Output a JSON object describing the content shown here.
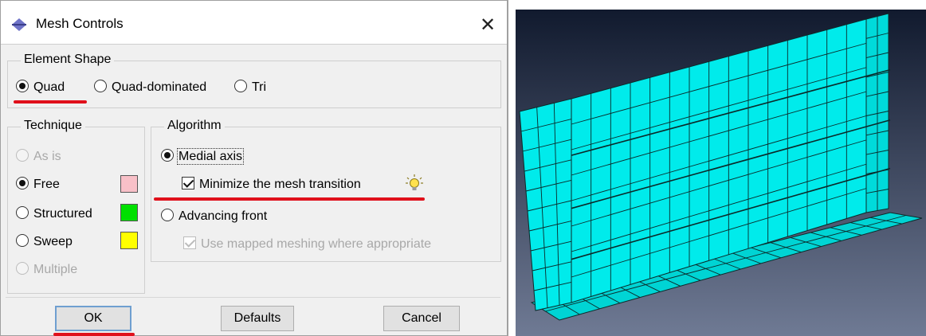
{
  "dialog": {
    "title": "Mesh Controls",
    "close_glyph": "✕",
    "icons": {
      "app": "mesh-controls-icon",
      "close": "close-icon",
      "hint": "lightbulb-icon"
    },
    "element_shape": {
      "legend": "Element Shape",
      "options": [
        {
          "label": "Quad",
          "selected": true
        },
        {
          "label": "Quad-dominated",
          "selected": false
        },
        {
          "label": "Tri",
          "selected": false
        }
      ]
    },
    "technique": {
      "legend": "Technique",
      "options": [
        {
          "label": "As is",
          "selected": false,
          "enabled": false
        },
        {
          "label": "Free",
          "selected": true,
          "enabled": true,
          "color": "#f8c0c8"
        },
        {
          "label": "Structured",
          "selected": false,
          "enabled": true,
          "color": "#00e000"
        },
        {
          "label": "Sweep",
          "selected": false,
          "enabled": true,
          "color": "#ffff00"
        },
        {
          "label": "Multiple",
          "selected": false,
          "enabled": false
        }
      ]
    },
    "algorithm": {
      "legend": "Algorithm",
      "medial_axis": {
        "label": "Medial axis",
        "selected": true
      },
      "minimize_transition": {
        "label": "Minimize the mesh transition",
        "checked": true
      },
      "advancing_front": {
        "label": "Advancing front",
        "selected": false
      },
      "mapped_meshing": {
        "label": "Use mapped meshing where appropriate",
        "checked": true,
        "enabled": false
      }
    },
    "buttons": {
      "ok": "OK",
      "defaults": "Defaults",
      "cancel": "Cancel"
    },
    "annotation_color": "#e0101b"
  },
  "viewport": {
    "background_top": "#111a2e",
    "background_bottom": "#6f7a94",
    "mesh_color": "#00ebeb",
    "edge_color": "#0b2a2a"
  }
}
